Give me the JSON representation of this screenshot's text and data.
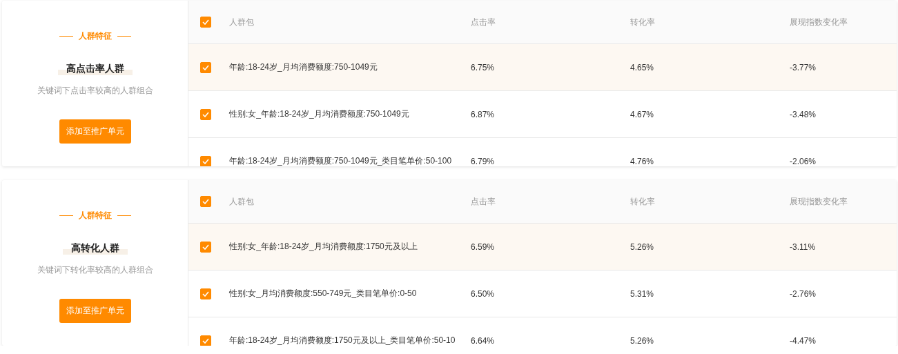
{
  "cards": [
    {
      "feature_label": "人群特征",
      "title": "高点击率人群",
      "description": "关键词下点击率较高的人群组合",
      "button": "添加至推广单元",
      "table": {
        "header_checked": true,
        "columns": [
          "人群包",
          "点击率",
          "转化率",
          "展现指数变化率"
        ],
        "rows": [
          {
            "checked": true,
            "highlighted": true,
            "cells": [
              "年龄:18-24岁_月均消费额度:750-1049元",
              "6.75%",
              "4.65%",
              "-3.77%"
            ]
          },
          {
            "checked": true,
            "highlighted": false,
            "cells": [
              "性别:女_年龄:18-24岁_月均消费额度:750-1049元",
              "6.87%",
              "4.67%",
              "-3.48%"
            ]
          },
          {
            "checked": true,
            "highlighted": false,
            "cells": [
              "年龄:18-24岁_月均消费额度:750-1049元_类目笔单价:50-100",
              "6.79%",
              "4.76%",
              "-2.06%"
            ]
          }
        ]
      }
    },
    {
      "feature_label": "人群特征",
      "title": "高转化人群",
      "description": "关键词下转化率较高的人群组合",
      "button": "添加至推广单元",
      "table": {
        "header_checked": true,
        "columns": [
          "人群包",
          "点击率",
          "转化率",
          "展现指数变化率"
        ],
        "rows": [
          {
            "checked": true,
            "highlighted": true,
            "cells": [
              "性别:女_年龄:18-24岁_月均消费额度:1750元及以上",
              "6.59%",
              "5.26%",
              "-3.11%"
            ]
          },
          {
            "checked": true,
            "highlighted": false,
            "cells": [
              "性别:女_月均消费额度:550-749元_类目笔单价:0-50",
              "6.50%",
              "5.31%",
              "-2.76%"
            ]
          },
          {
            "checked": true,
            "highlighted": false,
            "cells": [
              "年龄:18-24岁_月均消费额度:1750元及以上_类目笔单价:50-10",
              "6.64%",
              "5.26%",
              "-4.47%"
            ]
          }
        ]
      }
    }
  ]
}
